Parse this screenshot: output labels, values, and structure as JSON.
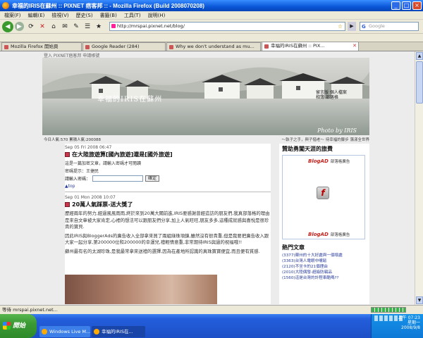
{
  "window": {
    "title": "幸福的IRIS在蘇州 :: PIXNET 痞客邦 :: - Mozilla Firefox (Build 2008070208)"
  },
  "menu": [
    "檔案(F)",
    "編輯(E)",
    "檢視(V)",
    "歷史(S)",
    "書籤(B)",
    "工具(T)",
    "說明(H)"
  ],
  "nav": {
    "url": "http://mrspai.pixnet.net/blog/",
    "search_placeholder": "Google",
    "search_brand": "G"
  },
  "tabs": [
    {
      "label": "Mozilla Firefox 開始頁",
      "active": false
    },
    {
      "label": "Google Reader (284)",
      "active": false
    },
    {
      "label": "Why we don't understand as mu...",
      "active": false
    },
    {
      "label": "幸福的IRIS在蘇州 :: PIX...",
      "active": true
    }
  ],
  "page": {
    "toplinks": "登入  PIXNET痞客邦  申請帳號",
    "banner_title": "幸福的IRIS在蘇州",
    "banner_stamp": "留言版  個人檔案  相簿  部落格",
    "banner_photo": "Photo by IRIS",
    "stats": "今日人氣:570  累積人氣:200088",
    "motto": "～執子之手，與子偕老～ 待幸福的腳步 蕩漾全世界",
    "post1": {
      "date": "Sep 05 Fri 2008 06:47",
      "title": "在大陸旅遊算[國內旅遊]還是[國外旅遊]",
      "locked": "這是一篇加密文章，請輸入密碼才可閱讀",
      "hint": "密碼提示：王捷民",
      "pw_label": "請輸入密碼：",
      "ok": "確定",
      "top": "▲top"
    },
    "post2": {
      "date": "Sep 01 Mon 2008 10:07",
      "title": "20萬人氣踩票-送大獎了",
      "p1": "歷經兩年的努力,經過風風雨雨,終於來到20萬大關前進,IRIS要感謝曾經造訪的朋友們,我真部落格的理由是來自文章被大家肯定,心裡的想法可以跟朋友們分享,加上人氣旺旺,朋友多多,這種成就感與喜悅是很珍貴的寶貝.",
      "p2": "因此IRIS與BloggerAds的廣告收入全部拿來買了兩組綠珠項鍊,雖然沒有很貴重,但是我要把廣告收入跟大家一起分享,第200000位和200000的幸運兒,禮輕情意重,非常期待IRIS與過的祝福哦!!",
      "p3": "蘇州最有名的太湖珍珠,是我最常拿來送禮的選擇,因為在產地所認識的真珠寶寶便宜,而且便有質感."
    },
    "sidebar": {
      "title": "贊助勇闖天涯的旅費",
      "ad_brand": "BlogAD",
      "ad_sub": "部落格廣告",
      "hot_title": "熱門文章",
      "hot_items": [
        "(3377)蘇州的十大好處與一個壞處",
        "(3363)台灣人電眼中嘴鬆",
        "(2120)不坐卡的21個理由",
        "(2010)大陸偶發-超級防竊品",
        "(1560)這是台灣的計程車酷嗎??"
      ]
    }
  },
  "status": {
    "text": "等待 mrspai.pixnet.net..."
  },
  "taskbar": {
    "start": "開始",
    "tasks": [
      "Windows Live M...",
      "幸福的IRIS在..."
    ],
    "time": "上午 07:23",
    "day": "星期一",
    "date": "2008/9/8"
  }
}
